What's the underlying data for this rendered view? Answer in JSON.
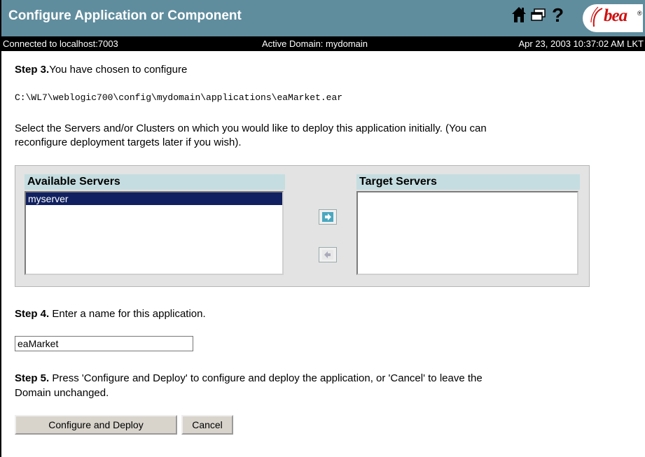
{
  "header": {
    "title": "Configure Application or Component",
    "icons": [
      "home-icon",
      "window-icon",
      "help-icon"
    ],
    "logo": "bea",
    "colors": {
      "titlebar": "#5f8d9e",
      "statusbar": "#000000"
    }
  },
  "status": {
    "connection": "Connected to localhost:7003",
    "domain": "Active Domain: mydomain",
    "datetime": "Apr 23, 2003 10:37:02 AM LKT"
  },
  "step3": {
    "label": "Step 3.",
    "text": "You have chosen to configure",
    "path": "C:\\WL7\\weblogic700\\config\\mydomain\\applications\\eaMarket.ear",
    "instructions_line1": "Select the Servers and/or Clusters on which you would like to deploy this application initially. (You can",
    "instructions_line2": "reconfigure deployment targets later if you wish)."
  },
  "servers": {
    "available_title": "Available Servers",
    "target_title": "Target Servers",
    "available": [
      "myserver"
    ],
    "target": []
  },
  "step4": {
    "label": "Step 4.",
    "text": "Enter a name for this application.",
    "app_name": "eaMarket"
  },
  "step5": {
    "label": "Step 5.",
    "text_line1": "Press 'Configure and Deploy' to configure and deploy the application, or 'Cancel' to leave the",
    "text_line2": "Domain unchanged."
  },
  "buttons": {
    "configure": "Configure and Deploy",
    "cancel": "Cancel"
  }
}
